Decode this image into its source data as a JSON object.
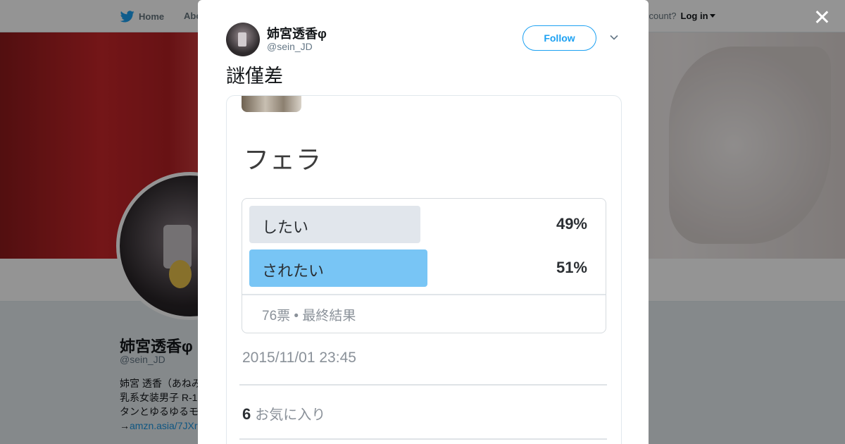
{
  "topbar": {
    "home_label": "Home",
    "about_label": "Abo",
    "account_prompt": "ccount?",
    "login_label": "Log in"
  },
  "profile": {
    "name": "姉宮透香φ",
    "handle": "@sein_JD",
    "bio_lines": [
      "姉宮 透香（あねみ",
      "乳系女装男子 R-1",
      "タンとゆるゆるモ"
    ],
    "bio_link": "amzn.asia/7JXr",
    "bio_arrow": "→"
  },
  "tweet": {
    "author_name": "姉宮透香φ",
    "author_handle": "@sein_JD",
    "follow_label": "Follow",
    "text": "謎僅差"
  },
  "media": {
    "poll_title": "フェラ",
    "options": [
      {
        "label": "したい",
        "percent_text": "49%",
        "percent": 49,
        "color": "#e1e6ec"
      },
      {
        "label": "されたい",
        "percent_text": "51%",
        "percent": 51,
        "color": "#78c5f5"
      }
    ],
    "poll_summary": "76票 • 最終結果",
    "timestamp": "2015/11/01 23:45",
    "likes_count": "6",
    "likes_label": "お気に入り"
  },
  "colors": {
    "accent": "#1da1f2",
    "winning_bar": "#78c5f5",
    "losing_bar": "#e1e6ec"
  },
  "icons": {
    "home": "twitter-bird-icon",
    "close": "close-icon",
    "menu": "chevron-down-icon"
  }
}
